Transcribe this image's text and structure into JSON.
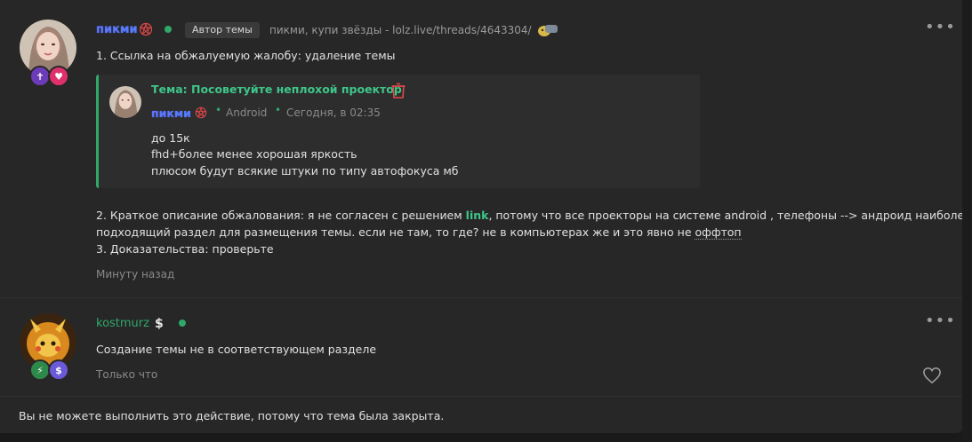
{
  "post1": {
    "username": "пикми",
    "author_tag": "Автор темы",
    "status": "пикми, купи звёзды - lolz.live/threads/4643304/",
    "line1": "1. Ссылка на обжалуемую жалобу: удаление темы",
    "quote": {
      "title": "Тема: Посоветуйте неплохой проектор",
      "username": "пикми",
      "platform": "Android",
      "time": "Сегодня, в 02:35",
      "lines": [
        "до 15к",
        "fhd+более менее хорошая яркость",
        "плюсом будут всякие штуки по типу автофокуса мб"
      ]
    },
    "line2_before": "2. Краткое описание обжалования: я не согласен с решением ",
    "line2_link": "link",
    "line2_after": ", потому что все проекторы на системе android , телефоны --> андроид наиболее",
    "line3_before": "подходящий раздел для размещения темы. если не там, то где? не в компьютерах же и это явно не ",
    "line3_term": "оффтоп",
    "line4": "3. Доказательства: проверьте",
    "time": "Минуту назад",
    "menu": "•••"
  },
  "post2": {
    "username": "kostmurz",
    "currency": "$",
    "text": "Создание темы не в соответствующем разделе",
    "time": "Только что",
    "menu": "•••"
  },
  "footer": {
    "notice": "Вы не можете выполнить это действие, потому что тема была закрыта."
  },
  "icons": {
    "online": "online-dot",
    "delete": "trash-icon",
    "like": "heart-icon",
    "more": "more-dots-icon"
  },
  "colors": {
    "accent_green": "#2fa86a",
    "link_green": "#3ec68a",
    "delete_red": "#e04848"
  }
}
